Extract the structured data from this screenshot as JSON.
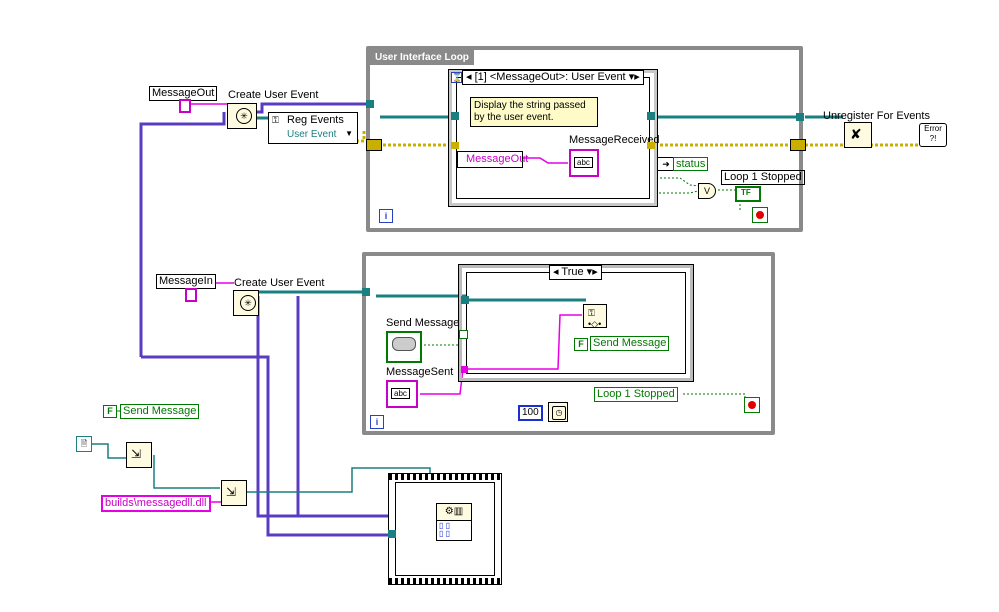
{
  "labels": {
    "message_out": "MessageOut",
    "message_in": "MessageIn",
    "create_user_event_1": "Create User Event",
    "create_user_event_2": "Create User Event",
    "unregister": "Unregister For Events",
    "message_received": "MessageReceived",
    "send_message": "Send Message",
    "message_sent": "MessageSent",
    "status": "status",
    "loop1_stopped": "Loop 1 Stopped"
  },
  "reg_events": {
    "title": "Reg Events",
    "item": "User Event"
  },
  "ui_loop": {
    "title": "User Interface Loop",
    "iter": "i"
  },
  "event_structure": {
    "selector": "[1] <MessageOut>: User Event",
    "comment_line1": "Display the string passed",
    "comment_line2": "by the user event.",
    "message_out_node": "MessageOut"
  },
  "case_structure": {
    "selector": "True"
  },
  "second_loop": {
    "iter": "i"
  },
  "constants": {
    "false_1": "F",
    "false_2": "F",
    "send_message_local_1": "Send Message",
    "send_message_local_2": "Send Message",
    "loop1_stopped_local": "Loop 1 Stopped",
    "wait_ms": "100",
    "dll_path": "builds\\messagedll.dll",
    "abc": "abc",
    "tf": "TF",
    "error": "Error"
  },
  "colors": {
    "wire_event": "#1a7f80",
    "wire_error": "#c9b000",
    "wire_string": "#e600e6",
    "wire_bool": "#007a00",
    "wire_ref": "#2a40c0",
    "loop_border": "#8a8a8a"
  }
}
